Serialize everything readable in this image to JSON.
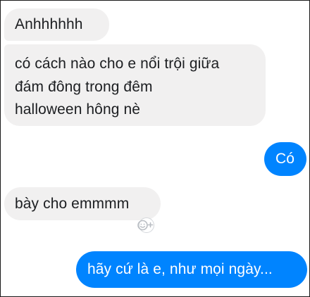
{
  "conversation": {
    "messages": [
      {
        "direction": "incoming",
        "lines": [
          "Anhhhhhh"
        ]
      },
      {
        "direction": "incoming",
        "lines": [
          "có cách nào cho e nổi trội giữa",
          "đám đông trong đêm",
          "halloween hông nè"
        ]
      },
      {
        "direction": "outgoing",
        "lines": [
          "Có"
        ]
      },
      {
        "direction": "incoming",
        "lines": [
          "bày cho emmmm"
        ]
      },
      {
        "direction": "outgoing",
        "lines": [
          "hãy cứ là e, như mọi ngày..."
        ]
      }
    ]
  },
  "reaction_button": {
    "icon": "smiley-add-reaction-icon"
  },
  "colors": {
    "incoming_bubble": "#f1f0f0",
    "incoming_text": "#1c1e21",
    "outgoing_bubble": "#0084ff",
    "outgoing_text": "#ffffff",
    "reaction_icon": "#c2c5ca"
  }
}
